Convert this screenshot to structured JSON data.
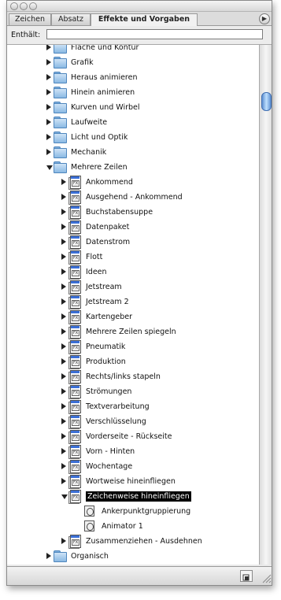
{
  "panel": {
    "tabs": [
      {
        "label": "Zeichen",
        "active": false
      },
      {
        "label": "Absatz",
        "active": false
      },
      {
        "label": "Effekte und Vorgaben",
        "active": true
      }
    ],
    "filter": {
      "label": "Enthält:",
      "value": ""
    }
  },
  "tree": [
    {
      "level": 0,
      "type": "folder",
      "label": "Fläche und Kontur",
      "expanded": false
    },
    {
      "level": 0,
      "type": "folder",
      "label": "Grafik",
      "expanded": false
    },
    {
      "level": 0,
      "type": "folder",
      "label": "Heraus animieren",
      "expanded": false
    },
    {
      "level": 0,
      "type": "folder",
      "label": "Hinein animieren",
      "expanded": false
    },
    {
      "level": 0,
      "type": "folder",
      "label": "Kurven und Wirbel",
      "expanded": false
    },
    {
      "level": 0,
      "type": "folder",
      "label": "Laufweite",
      "expanded": false
    },
    {
      "level": 0,
      "type": "folder",
      "label": "Licht und Optik",
      "expanded": false
    },
    {
      "level": 0,
      "type": "folder",
      "label": "Mechanik",
      "expanded": false
    },
    {
      "level": 0,
      "type": "folder",
      "label": "Mehrere Zeilen",
      "expanded": true
    },
    {
      "level": 1,
      "type": "preset",
      "label": "Ankommend",
      "expanded": false
    },
    {
      "level": 1,
      "type": "preset",
      "label": "Ausgehend - Ankommend",
      "expanded": false
    },
    {
      "level": 1,
      "type": "preset",
      "label": "Buchstabensuppe",
      "expanded": false
    },
    {
      "level": 1,
      "type": "preset",
      "label": "Datenpaket",
      "expanded": false
    },
    {
      "level": 1,
      "type": "preset",
      "label": "Datenstrom",
      "expanded": false
    },
    {
      "level": 1,
      "type": "preset",
      "label": "Flott",
      "expanded": false
    },
    {
      "level": 1,
      "type": "preset",
      "label": "Ideen",
      "expanded": false
    },
    {
      "level": 1,
      "type": "preset",
      "label": "Jetstream",
      "expanded": false
    },
    {
      "level": 1,
      "type": "preset",
      "label": "Jetstream 2",
      "expanded": false
    },
    {
      "level": 1,
      "type": "preset",
      "label": "Kartengeber",
      "expanded": false
    },
    {
      "level": 1,
      "type": "preset",
      "label": "Mehrere Zeilen spiegeln",
      "expanded": false
    },
    {
      "level": 1,
      "type": "preset",
      "label": "Pneumatik",
      "expanded": false
    },
    {
      "level": 1,
      "type": "preset",
      "label": "Produktion",
      "expanded": false
    },
    {
      "level": 1,
      "type": "preset",
      "label": "Rechts/links stapeln",
      "expanded": false
    },
    {
      "level": 1,
      "type": "preset",
      "label": "Strömungen",
      "expanded": false
    },
    {
      "level": 1,
      "type": "preset",
      "label": "Textverarbeitung",
      "expanded": false
    },
    {
      "level": 1,
      "type": "preset",
      "label": "Verschlüsselung",
      "expanded": false
    },
    {
      "level": 1,
      "type": "preset",
      "label": "Vorderseite - Rückseite",
      "expanded": false
    },
    {
      "level": 1,
      "type": "preset",
      "label": "Vorn - Hinten",
      "expanded": false
    },
    {
      "level": 1,
      "type": "preset",
      "label": "Wochentage",
      "expanded": false
    },
    {
      "level": 1,
      "type": "preset",
      "label": "Wortweise hineinfliegen",
      "expanded": false
    },
    {
      "level": 1,
      "type": "preset",
      "label": "Zeichenweise hineinfliegen",
      "expanded": true,
      "selected": true
    },
    {
      "level": 2,
      "type": "animator",
      "label": "Ankerpunktgruppierung"
    },
    {
      "level": 2,
      "type": "animator",
      "label": "Animator 1"
    },
    {
      "level": 1,
      "type": "preset",
      "label": "Zusammenziehen - Ausdehnen",
      "expanded": false
    },
    {
      "level": 0,
      "type": "folder",
      "label": "Organisch",
      "expanded": false
    },
    {
      "level": 0,
      "type": "folder",
      "label": "",
      "expanded": false
    }
  ]
}
